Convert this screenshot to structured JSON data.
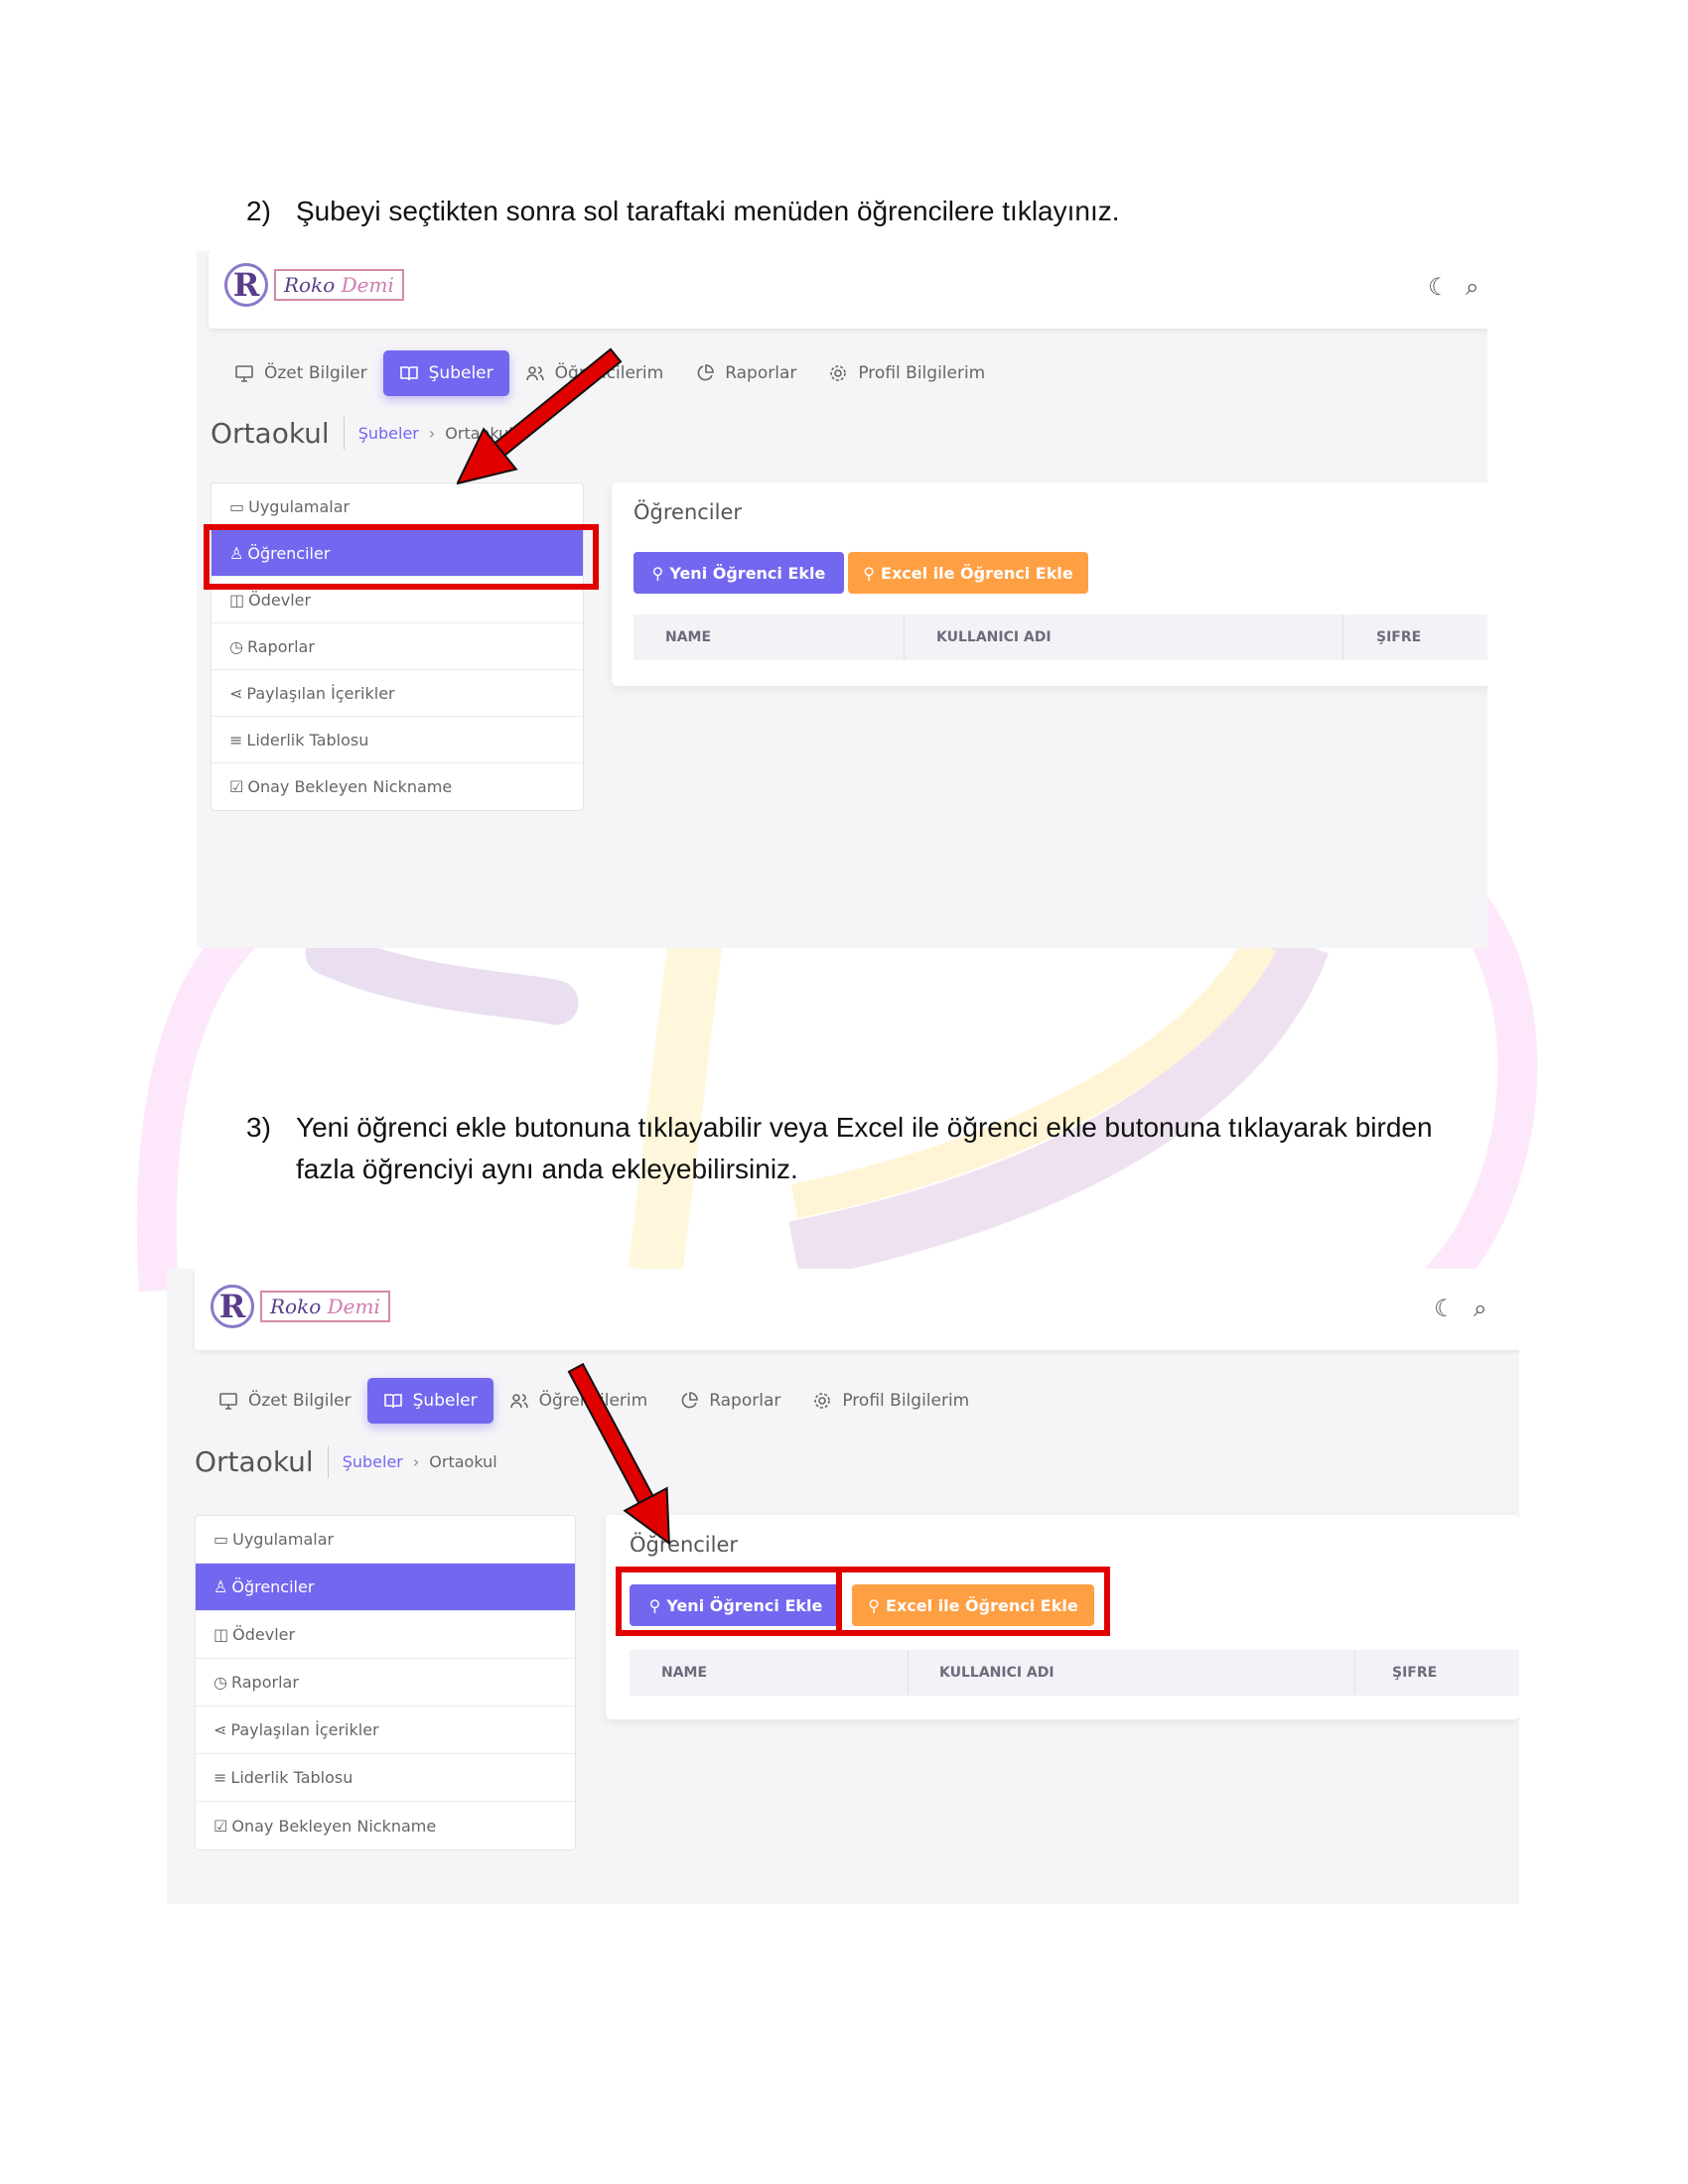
{
  "step2": {
    "number": "2)",
    "text": "Şubeyi seçtikten sonra sol taraftaki menüden öğrencilere tıklayınız."
  },
  "step3": {
    "number": "3)",
    "line1": "Yeni öğrenci ekle butonuna tıklayabilir veya Excel ile öğrenci ekle butonuna tıklayarak birden",
    "line2": "fazla öğrenciyi aynı anda ekleyebilirsiniz."
  },
  "logo": {
    "letter": "R",
    "word_part1": "Roko ",
    "word_part2": "Demi"
  },
  "nav": {
    "summary": "Özet Bilgiler",
    "branches": "Şubeler",
    "students": "Öğrencilerim",
    "reports": "Raporlar",
    "profile": "Profil Bilgilerim"
  },
  "page": {
    "title": "Ortaokul",
    "breadcrumb_link": "Şubeler",
    "breadcrumb_sep": "›",
    "breadcrumb_current": "Ortaokul"
  },
  "side_menu": {
    "applications": "Uygulamalar",
    "students": "Öğrenciler",
    "homework": "Ödevler",
    "reports": "Raporlar",
    "shared": "Paylaşılan İçerikler",
    "leaderboard": "Liderlik Tablosu",
    "nickname": "Onay Bekleyen Nickname"
  },
  "card": {
    "title": "Öğrenciler",
    "add_button": "Yeni Öğrenci Ekle",
    "excel_button": "Excel ile Öğrenci Ekle",
    "columns_a": [
      "NAME",
      "KULLANICI ADI",
      "ŞIFRE"
    ],
    "columns_b": [
      "NAME",
      "KULLANICI ADI",
      "ŞIFRE"
    ]
  },
  "colors": {
    "primary": "#7367f0",
    "warning": "#ff9f43",
    "highlight": "#e00000"
  },
  "icons": [
    "moon-icon",
    "search-icon",
    "monitor-icon",
    "book-open-icon",
    "users-icon",
    "pie-chart-icon",
    "settings-icon",
    "user-icon",
    "user-plus-icon",
    "share-icon",
    "list-icon",
    "check-square-icon",
    "calendar-icon"
  ]
}
